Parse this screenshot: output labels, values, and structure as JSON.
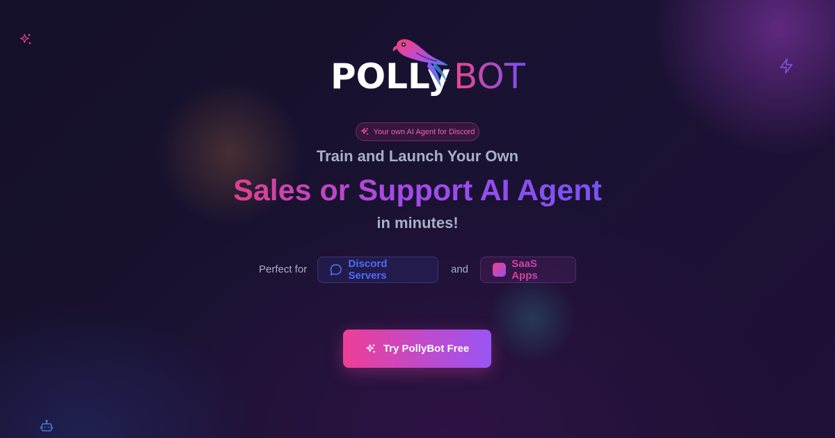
{
  "brand": {
    "name_part1": "POLLy",
    "name_part2": "BOT",
    "logo_icon": "parrot-icon"
  },
  "badge": {
    "icon": "sparkles-icon",
    "text": "Your own AI Agent for Discord"
  },
  "headline": {
    "line1": "Train and Launch Your Own",
    "line2": "Sales or Support AI Agent",
    "line3": "in minutes!"
  },
  "use_cases": {
    "label": "Perfect for",
    "connector": "and",
    "items": [
      {
        "icon": "chat-bubble-icon",
        "label": "Discord Servers"
      },
      {
        "icon": "app-square-icon",
        "label": "SaaS Apps"
      }
    ]
  },
  "cta": {
    "icon": "sparkles-icon",
    "label": "Try PollyBot Free"
  },
  "decorations": [
    "sparkles-icon",
    "lightning-icon",
    "bot-icon"
  ],
  "colors": {
    "background": "#141029",
    "accent_pink": "#ee3e96",
    "accent_purple": "#7a52f4",
    "discord_blue": "#4f6bff",
    "muted_text": "#a8b0c8"
  }
}
